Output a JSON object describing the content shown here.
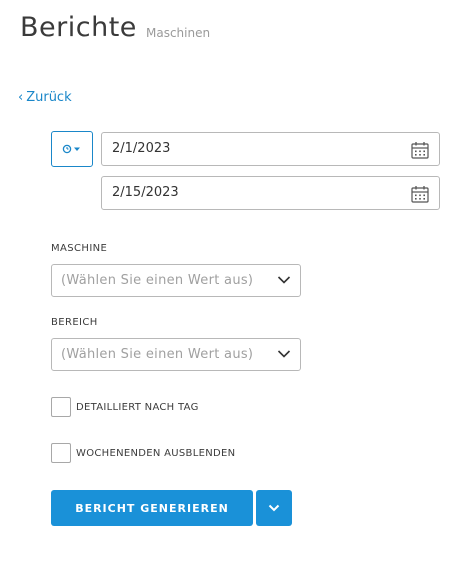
{
  "header": {
    "title": "Berichte",
    "subtitle": "Maschinen"
  },
  "navigation": {
    "back_label": "Zurück"
  },
  "date_range": {
    "start_date": "2/1/2023",
    "end_date": "2/15/2023",
    "time_selector_icon": "clock-icon"
  },
  "filters": {
    "machine": {
      "label": "MASCHINE",
      "placeholder": "(Wählen Sie einen Wert aus)"
    },
    "area": {
      "label": "BEREICH",
      "placeholder": "(Wählen Sie einen Wert aus)"
    }
  },
  "options": {
    "detailed_by_day": {
      "label": "DETAILLIERT NACH TAG",
      "checked": false
    },
    "hide_weekends": {
      "label": "WOCHENENDEN AUSBLENDEN",
      "checked": false
    }
  },
  "actions": {
    "generate_label": "BERICHT GENERIEREN",
    "dropdown_icon": "chevron-down-icon"
  },
  "colors": {
    "accent": "#1a91d8",
    "link": "#1a87c9",
    "border": "#b8b8b8",
    "placeholder": "#a0a0a0"
  }
}
